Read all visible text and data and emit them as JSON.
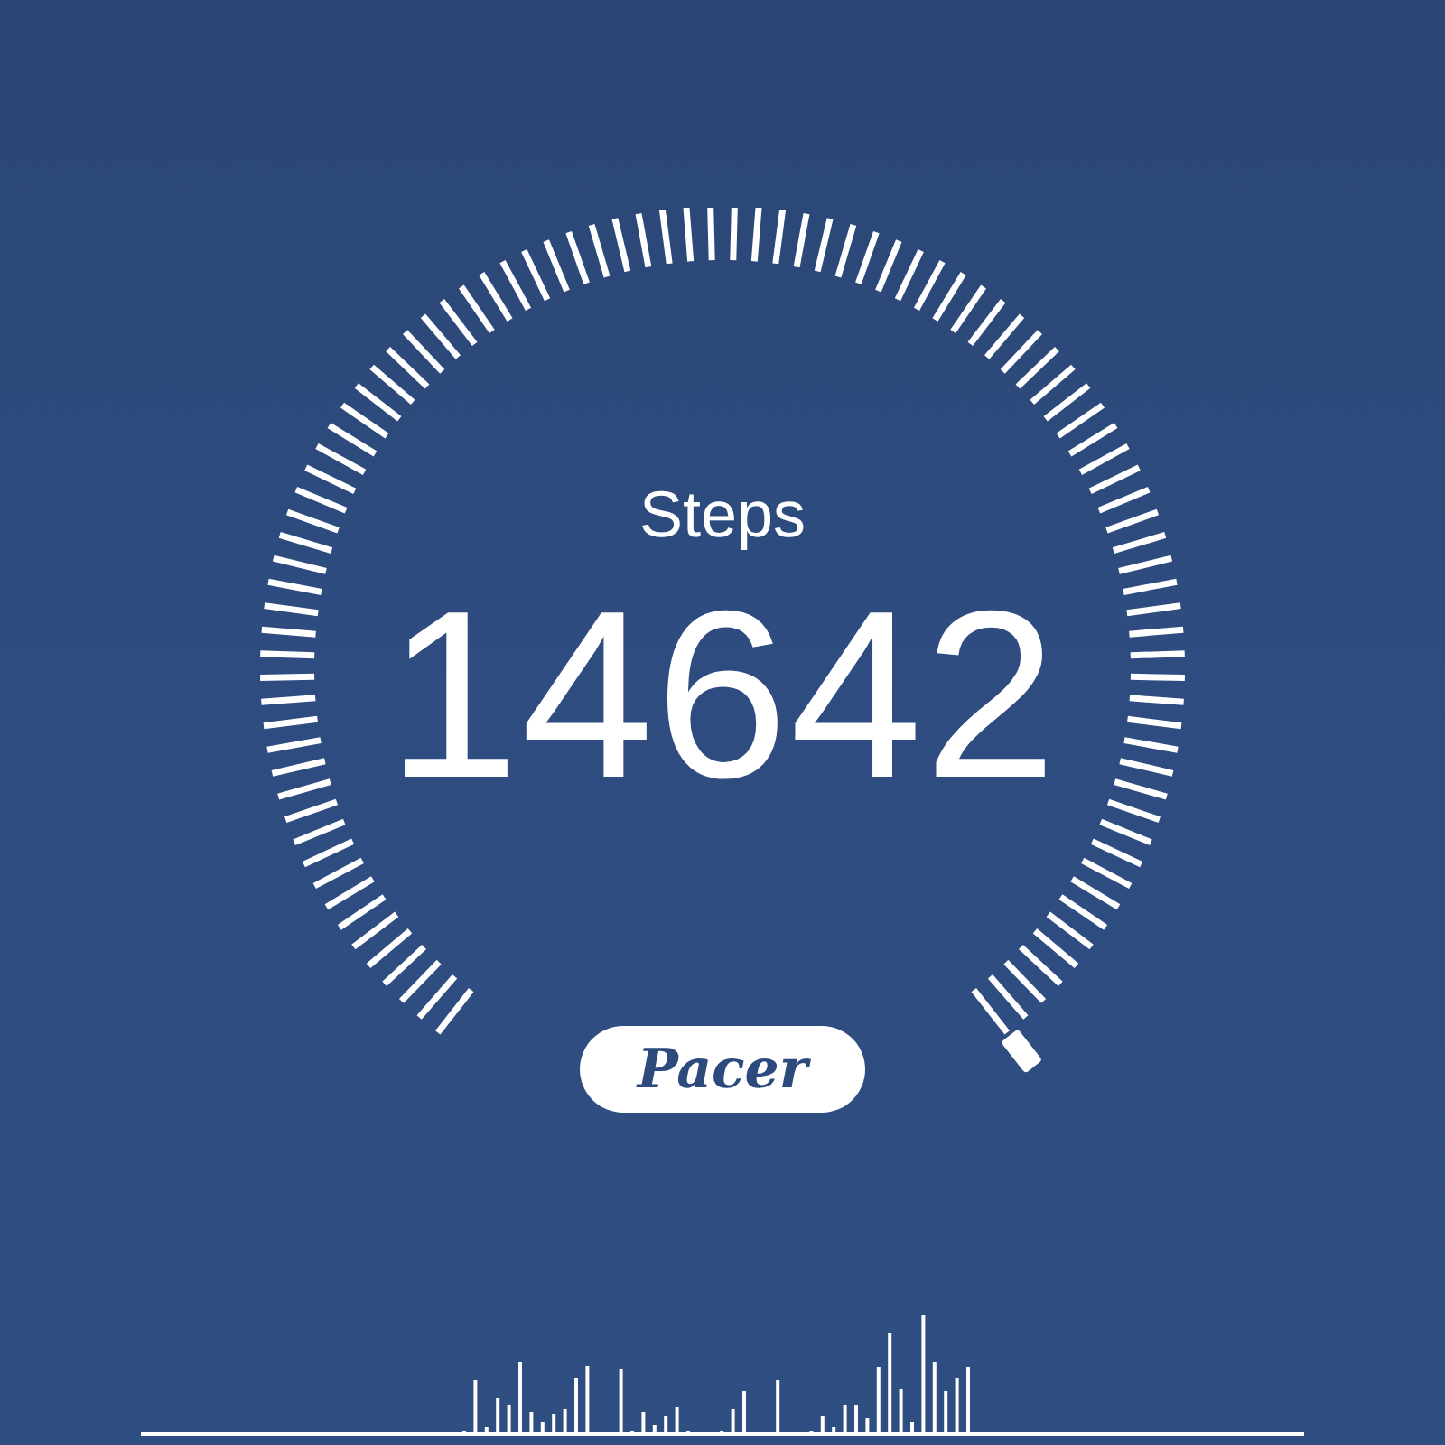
{
  "gauge": {
    "label": "Steps",
    "value": "14642"
  },
  "brand": {
    "label": "Pacer"
  }
}
